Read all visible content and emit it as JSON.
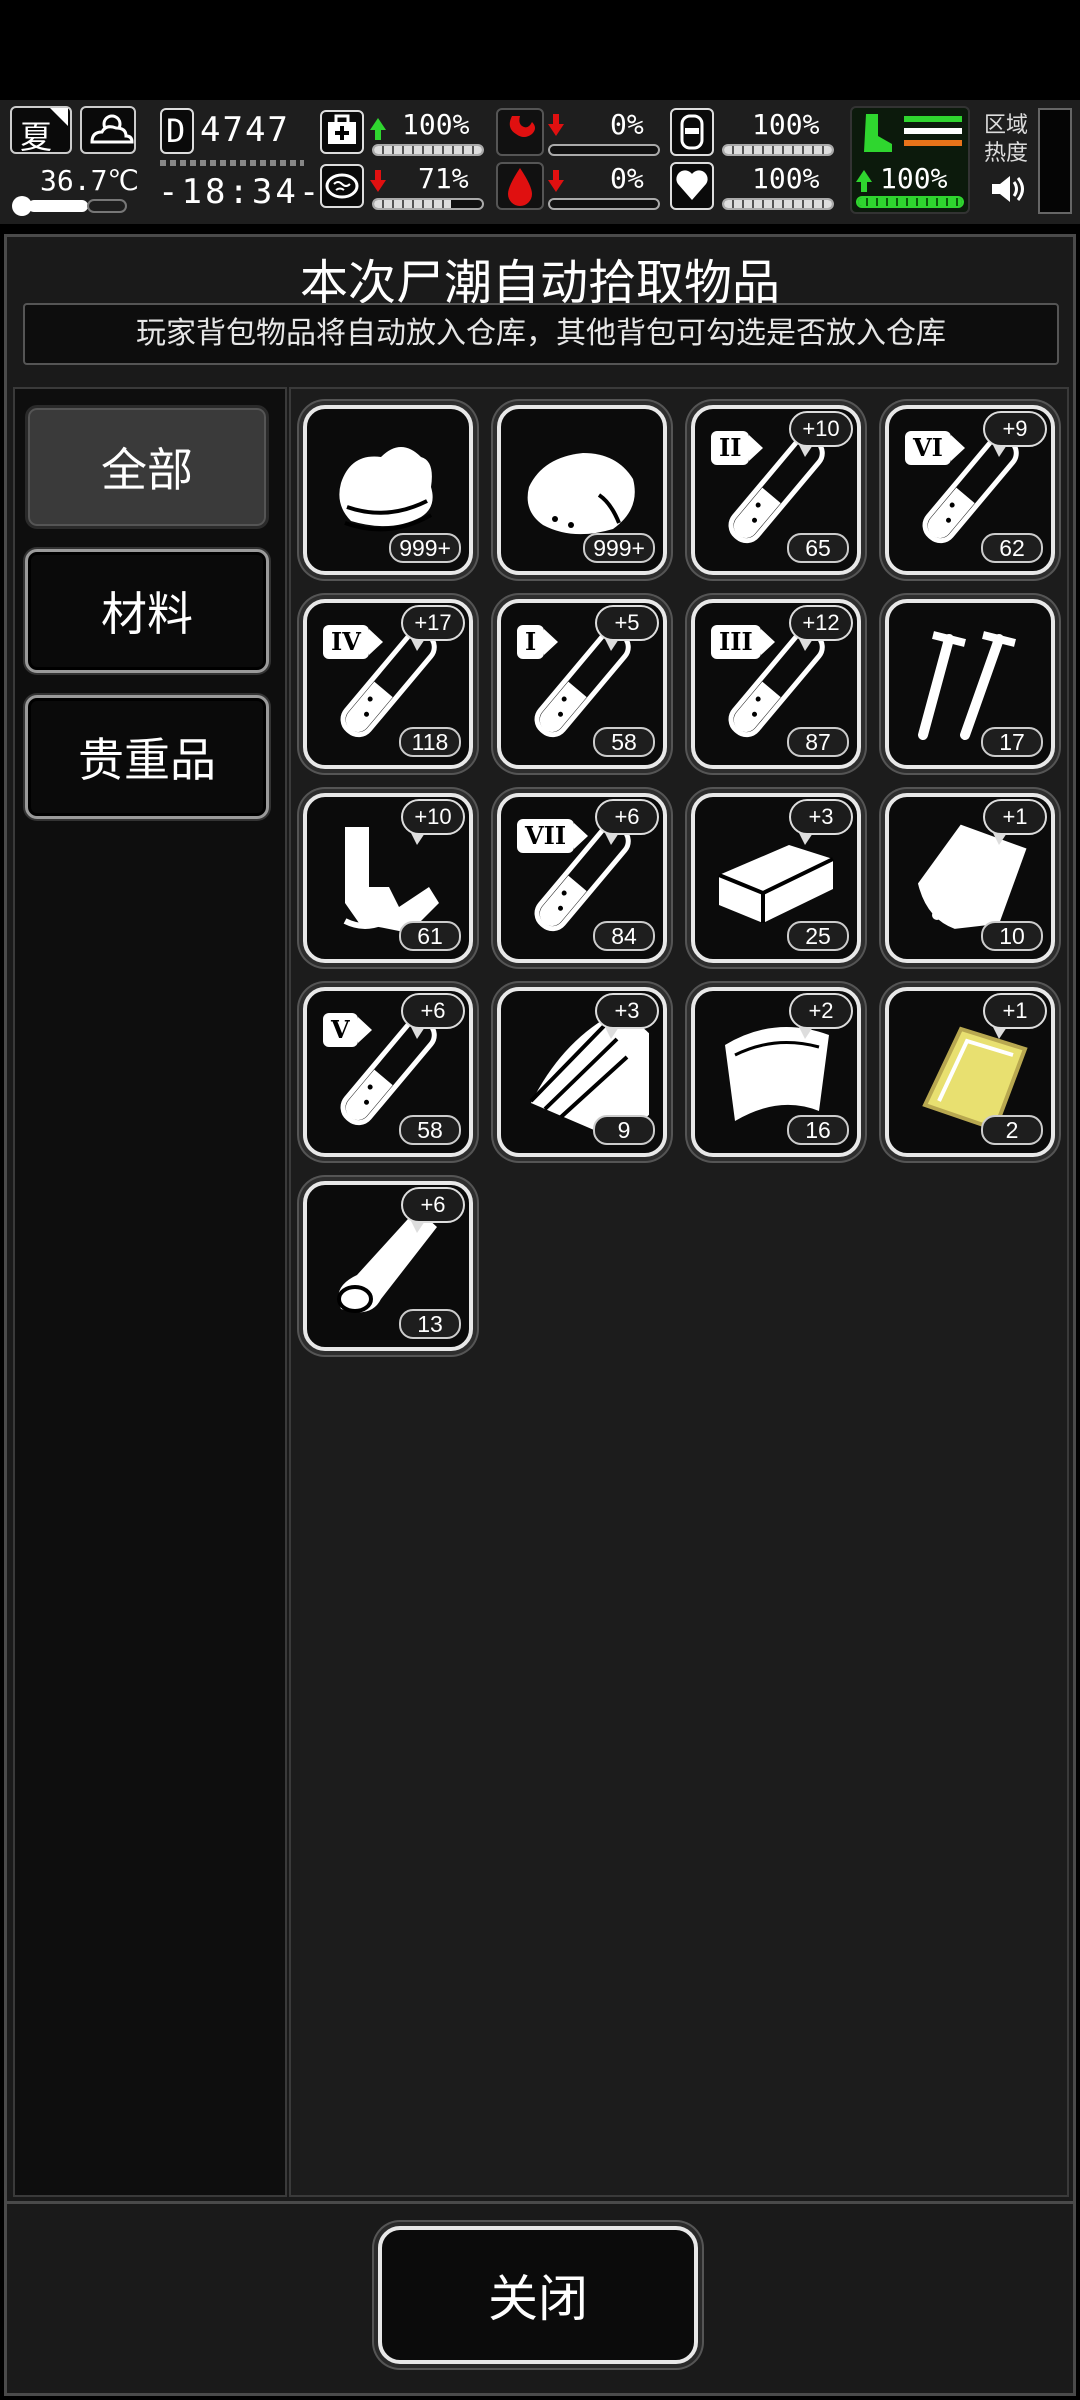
{
  "status": {
    "season": "夏",
    "temperature": "36.7℃",
    "day_counter": "4747",
    "clock": "-18:34-",
    "health": {
      "value": "100%",
      "trend": "up",
      "level": 1.0
    },
    "brain": {
      "value": "71%",
      "trend": "down",
      "level": 0.71
    },
    "hunger": {
      "value": "0%",
      "trend": "down",
      "level": 0.0
    },
    "blood": {
      "value": "0%",
      "trend": "down",
      "level": 0.0
    },
    "water": {
      "value": "100%",
      "level": 1.0
    },
    "heart": {
      "value": "100%",
      "level": 1.0
    },
    "stamina": {
      "value": "100%",
      "trend": "up",
      "level": 1.0
    },
    "zone_heat_label": "区域热度",
    "colors": {
      "green": "#2fd62f",
      "red": "#e01010",
      "orange": "#e8731a",
      "gold": "#e8e070"
    }
  },
  "panel": {
    "title": "本次尸潮自动拾取物品",
    "notice": "玩家背包物品将自动放入仓库，其他背包可勾选是否放入仓库"
  },
  "tabs": [
    {
      "label": "全部",
      "active": true
    },
    {
      "label": "材料",
      "active": false
    },
    {
      "label": "贵重品",
      "active": false
    }
  ],
  "items": [
    {
      "icon": "cloth-icon",
      "count": "999+",
      "bonus": ""
    },
    {
      "icon": "meat-icon",
      "count": "999+",
      "bonus": ""
    },
    {
      "icon": "test-tube-icon",
      "roman": "II",
      "count": "65",
      "bonus": "+10"
    },
    {
      "icon": "test-tube-icon",
      "roman": "VI",
      "count": "62",
      "bonus": "+9"
    },
    {
      "icon": "test-tube-icon",
      "roman": "IV",
      "count": "118",
      "bonus": "+17"
    },
    {
      "icon": "test-tube-icon",
      "roman": "I",
      "count": "58",
      "bonus": "+5"
    },
    {
      "icon": "test-tube-icon",
      "roman": "III",
      "count": "87",
      "bonus": "+12"
    },
    {
      "icon": "nails-icon",
      "count": "17",
      "bonus": ""
    },
    {
      "icon": "scrap-parts-icon",
      "count": "61",
      "bonus": "+10"
    },
    {
      "icon": "test-tube-icon",
      "roman": "VII",
      "count": "84",
      "bonus": "+6"
    },
    {
      "icon": "brick-icon",
      "count": "25",
      "bonus": "+3"
    },
    {
      "icon": "bag-icon",
      "count": "10",
      "bonus": "+1"
    },
    {
      "icon": "test-tube-icon",
      "roman": "V",
      "count": "58",
      "bonus": "+6"
    },
    {
      "icon": "wood-planks-icon",
      "count": "9",
      "bonus": "+3"
    },
    {
      "icon": "leather-icon",
      "count": "16",
      "bonus": "+2"
    },
    {
      "icon": "gold-card-icon",
      "count": "2",
      "bonus": "+1"
    },
    {
      "icon": "log-icon",
      "count": "13",
      "bonus": "+6"
    }
  ],
  "footer": {
    "close_label": "关闭"
  }
}
